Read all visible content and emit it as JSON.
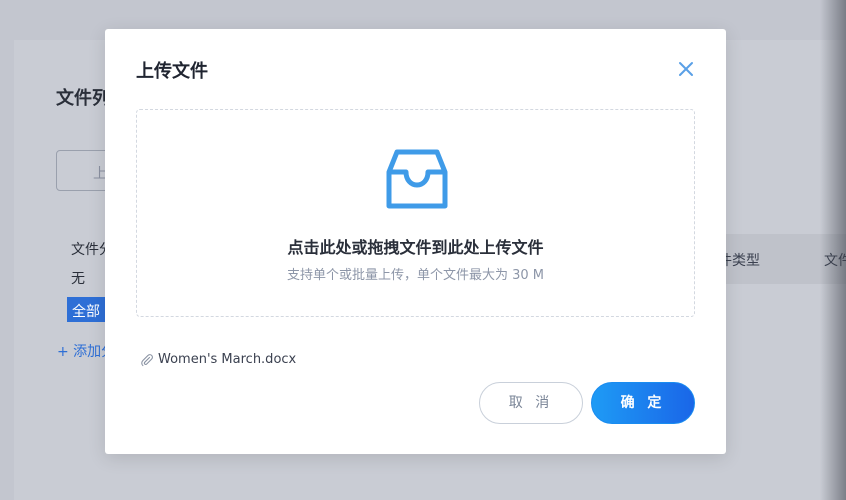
{
  "background": {
    "title": "文件列",
    "upload_button": "上",
    "filter_label": "文件分",
    "filter_none": "无",
    "all_tag": "全部",
    "add_category": "+ 添加分",
    "table_headers": [
      "件类型",
      "文件"
    ]
  },
  "modal": {
    "title": "上传文件",
    "close_icon": "close-icon",
    "dropzone": {
      "icon": "inbox-icon",
      "main_text": "点击此处或拖拽文件到此处上传文件",
      "sub_text": "支持单个或批量上传，单个文件最大为 30 M"
    },
    "files": [
      {
        "icon": "paperclip-icon",
        "name": "Women's March.docx"
      }
    ],
    "buttons": {
      "cancel": "取 消",
      "ok": "确 定"
    }
  },
  "colors": {
    "accent": "#1a8cf0",
    "icon": "#3f9be8",
    "overlay": "#c3c6cf"
  }
}
